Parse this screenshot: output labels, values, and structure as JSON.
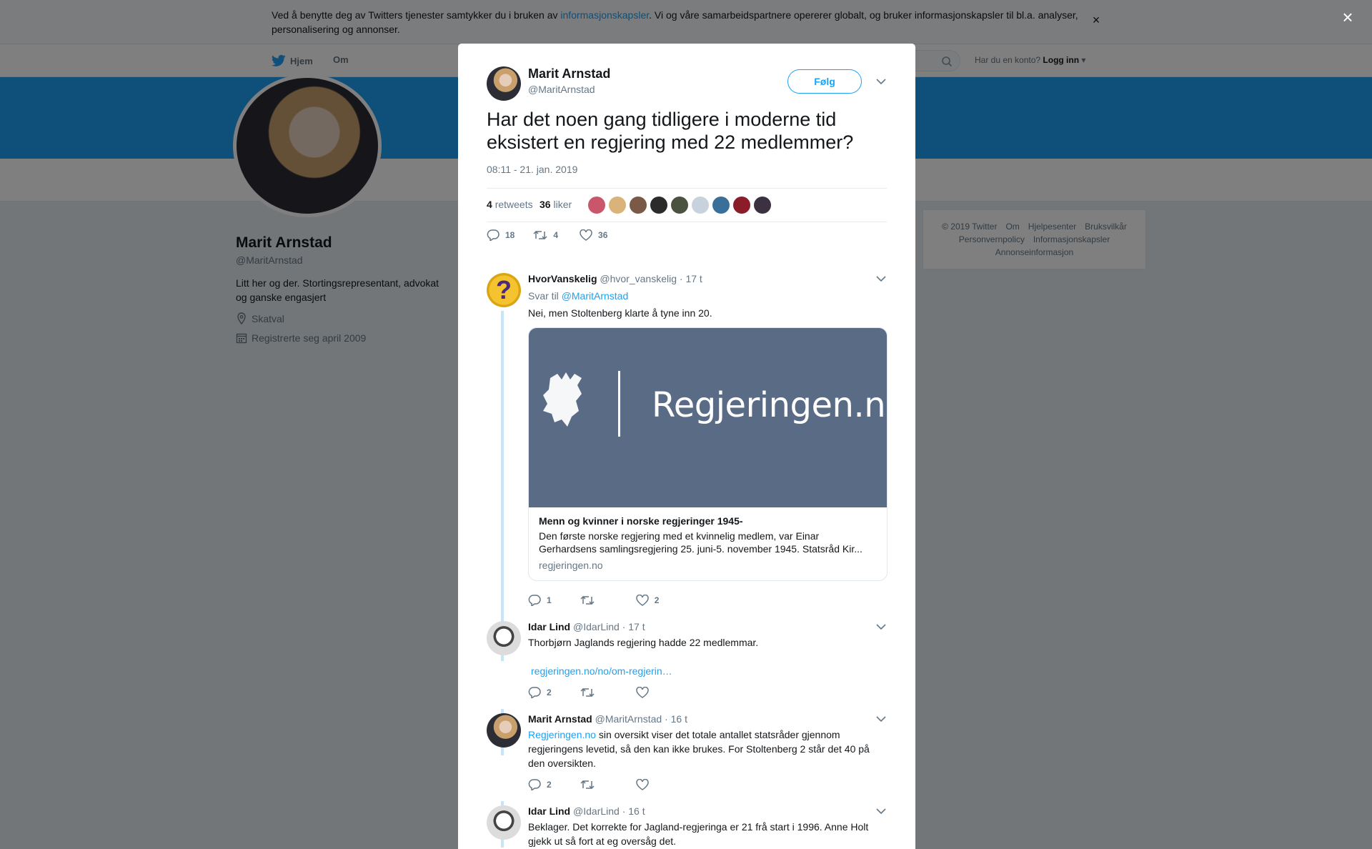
{
  "cookie": {
    "text_before": "Ved å benytte deg av Twitters tjenester samtykker du i bruken av ",
    "link": "informasjonskapsler",
    "text_after": ". Vi og våre samarbeidspartnere opererer globalt, og bruker informasjonskapsler til bl.a. analyser, personalisering og annonser.",
    "close": "×"
  },
  "nav": {
    "home": "Hjem",
    "about": "Om",
    "login_prompt": "Har du en konto?",
    "login": "Logg inn"
  },
  "profile": {
    "name": "Marit Arnstad",
    "handle": "@MaritArnstad",
    "bio": "Litt her og der. Stortingsrepresentant, advokat og ganske engasjert",
    "location": "Skatval",
    "joined": "Registrerte seg april 2009"
  },
  "footer": {
    "line1": [
      "© 2019 Twitter",
      "Om",
      "Hjelpesenter",
      "Bruksvilkår"
    ],
    "line2": [
      "Personvernpolicy",
      "Informasjonskapsler"
    ],
    "line3": [
      "Annonseinformasjon"
    ]
  },
  "modal": {
    "close": "×",
    "author_name": "Marit Arnstad",
    "author_handle": "@MaritArnstad",
    "follow": "Følg",
    "text": "Har det noen gang tidligere i moderne tid eksistert en regjering med 22 medlemmer?",
    "time": "08:11 - 21. jan. 2019",
    "retweets_count": "4",
    "retweets_label": "retweets",
    "likes_count": "36",
    "likes_label": "liker",
    "reply_count": "18",
    "rt_count": "4",
    "like_count": "36"
  },
  "replies": [
    {
      "name": "HvorVanskelig",
      "handle": "@hvor_vanskelig",
      "time": "· 17 t",
      "reply_to_label": "Svar til",
      "reply_to": "@MaritArnstad",
      "text": "Nei, men Stoltenberg klarte å tyne inn 20.",
      "card": {
        "image_text": "Regjeringen.no",
        "title": "Menn og kvinner i norske regjeringer 1945-",
        "desc": "Den første norske regjering med et kvinnelig medlem, var Einar Gerhardsens samlingsregjering 25. juni-5. november 1945. Statsråd Kir...",
        "domain": "regjeringen.no"
      },
      "replies": "1",
      "retweets": "",
      "likes": "2"
    },
    {
      "name": "Idar Lind",
      "handle": "@IdarLind",
      "time": "· 17 t",
      "text": "Thorbjørn Jaglands regjering hadde 22 medlemmar.",
      "link": "regjeringen.no/no/om-regjerin…",
      "replies": "2",
      "retweets": "",
      "likes": ""
    },
    {
      "name": "Marit Arnstad",
      "handle": "@MaritArnstad",
      "time": "· 16 t",
      "link": "Regjeringen.no",
      "text": " sin oversikt viser det totale antallet statsråder gjennom regjeringens levetid, så den kan ikke brukes. For Stoltenberg 2 står det 40 på den oversikten.",
      "replies": "2",
      "retweets": "",
      "likes": ""
    },
    {
      "name": "Idar Lind",
      "handle": "@IdarLind",
      "time": "· 16 t",
      "text": "Beklager. Det korrekte for Jagland-regjeringa er 21 frå start i 1996. Anne Holt gjekk ut så fort at eg oversåg det."
    }
  ],
  "colors": {
    "brand": "#1da1f2",
    "text": "#14171a",
    "muted": "#657786"
  }
}
